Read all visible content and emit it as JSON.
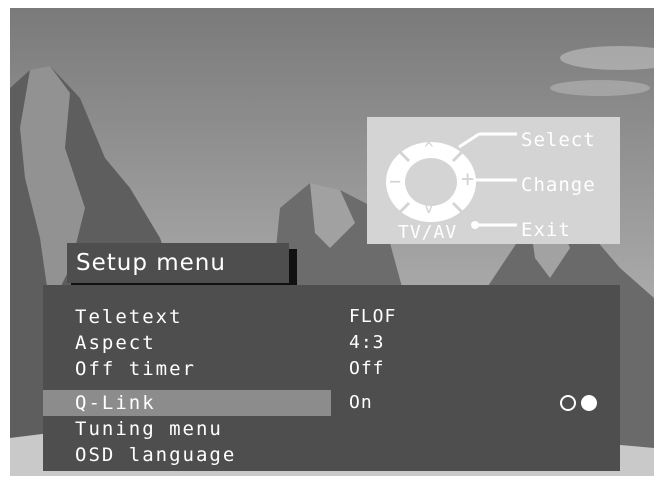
{
  "key_guide": {
    "select_label": "Select",
    "change_label": "Change",
    "exit_label": "Exit",
    "tvav_label": "TV/AV",
    "up_symbol": "^",
    "down_symbol": "v",
    "minus_symbol": "−",
    "plus_symbol": "+"
  },
  "menu": {
    "title": "Setup menu",
    "items": [
      {
        "label": "Teletext",
        "value": "FLOF"
      },
      {
        "label": "Aspect",
        "value": "4:3"
      },
      {
        "label": "Off timer",
        "value": "Off"
      },
      {
        "label": "Q-Link",
        "value": "On",
        "selected": true
      },
      {
        "label": "Tuning menu",
        "value": ""
      },
      {
        "label": "OSD language",
        "value": ""
      }
    ],
    "page_indicator": {
      "total": 2,
      "current": 2
    }
  },
  "colors": {
    "panel": "#4e4e4e",
    "highlight": "#8c8c8c",
    "guide_panel": "#d4d4d4",
    "text": "#ffffff"
  }
}
